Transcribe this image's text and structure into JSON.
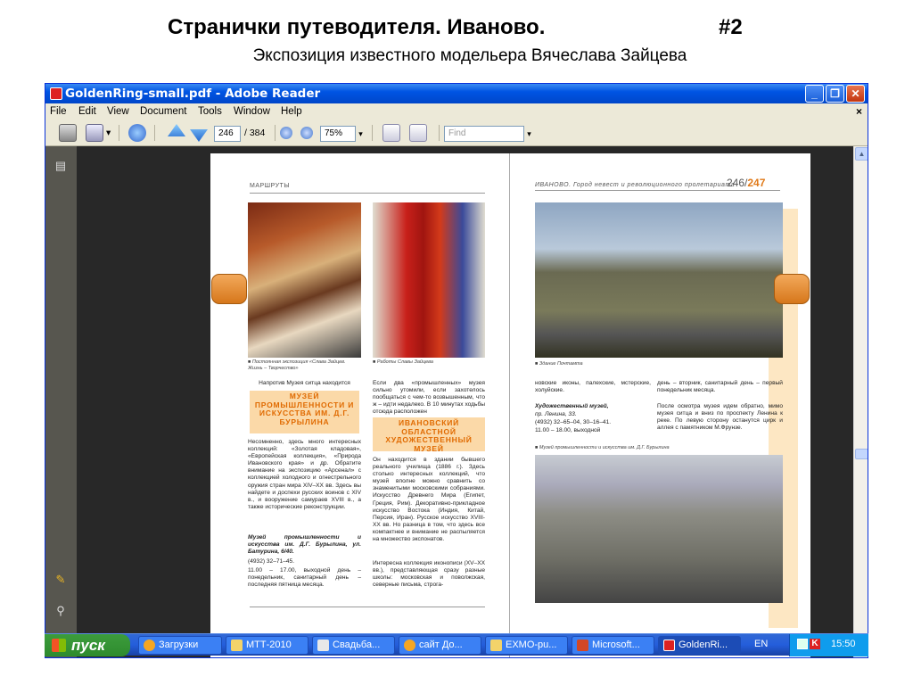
{
  "slide": {
    "title": "Странички путеводителя. Иваново.",
    "number": "#2",
    "subtitle": "Экспозиция известного модельера Вячеслава Зайцева"
  },
  "window": {
    "title": "GoldenRing-small.pdf - Adobe Reader",
    "min": "_",
    "max": "❐",
    "close": "✕"
  },
  "menu": [
    "File",
    "Edit",
    "View",
    "Document",
    "Tools",
    "Window",
    "Help"
  ],
  "menu_close": "×",
  "toolbar": {
    "page_current": "246",
    "page_total": "/ 384",
    "zoom": "75%",
    "find_placeholder": "Find"
  },
  "icons": [
    "print-icon",
    "email-icon",
    "hand-icon",
    "arrow-up-icon",
    "arrow-down-icon",
    "zoom-out-icon",
    "zoom-in-icon",
    "fit-width-icon",
    "fit-page-icon",
    "pages-icon",
    "comment-icon",
    "attachment-icon"
  ],
  "left_page": {
    "header": "МАРШРУТЫ",
    "caption1": "■ Постоянная экспозиция «Слава Зайцев. Жизнь – Творчество»",
    "caption2": "■ Работы Славы Зайцева",
    "col1_intro": "Напротив Музея ситца находится",
    "box1": "МУЗЕЙ ПРОМЫШЛЕННОСТИ И ИСКУССТВА ИМ. Д.Г. БУРЫЛИНА",
    "col1_body": "Несомненно, здесь много интересных коллекций: «Золотая кладовая», «Европейская коллекция», «Природа Ивановского края» и др. Обратите внимание на экспозицию «Арсенал» с коллекцией холодного и огнестрельного оружия стран мира XIV–XX вв. Здесь вы найдете и доспехи русских воинов с XIV в., и вооружение самураев XVIII в., а также исторические реконструкции.",
    "col1_info": "Музей промышленности и искусства им. Д.Г. Бурылина, ул. Батурина, 6/40.",
    "col1_phone": "(4932) 32–71–45.",
    "col1_hours": "11.00 – 17.00, выходной день – понедельник, санитарный день – последняя пятница месяца.",
    "col2_intro": "Если два «промышленных» музея сильно утомили, если захотелось пообщаться с чем-то возвышенным, что ж – идти недалеко. В 10 минутах ходьбы отсюда расположен",
    "box2": "ИВАНОВСКИЙ ОБЛАСТНОЙ ХУДОЖЕСТВЕННЫЙ МУЗЕЙ",
    "col2_body": "Он находится в здании бывшего реального училища (1886 г.). Здесь столько интересных коллекций, что музей вполне можно сравнить со знаменитыми московскими собраниями. Искусство Древнего Мира (Египет, Греция, Рим). Декоративно-прикладное искусство Востока (Индия, Китай, Персия, Иран). Русское искусство XVIII-XX вв. Но разница в том, что здесь все компактнее и внимание не распыляется на множество экспонатов.",
    "col2_body2": "Интересна коллекция иконописи (XV–XX вв.), представляющая сразу разные школы: московская и поволжская, северные письма, строга-"
  },
  "right_page": {
    "header": "ИВАНОВО. Город невест и революционного пролетариата",
    "page_a": "246/",
    "page_b": "247",
    "caption1": "■ Здание Почтамта",
    "col1_text": "новские иконы, палехские, мстерские, холуйские.",
    "col1_museum": "Художественный музей,",
    "col1_addr": "пр. Ленина, 33.",
    "col1_phone": "(4932) 32–65–04, 30–16–41.",
    "col1_hours": "11.00 – 18.00, выходной",
    "col2_hours": "день – вторник, санитарный день – первый понедельник месяца.",
    "col2_body": "После осмотра музея идем обратно, мимо музея ситца и вниз по проспекту Ленина к реке. По левую сторону останутся цирк и аллея с памятником М.Фрунзе.",
    "caption2": "■ Музей промышленности и искусства им. Д.Г. Бурылина"
  },
  "taskbar": {
    "start": "пуск",
    "tasks": [
      "Загрузки",
      "МТТ-2010",
      "Свадьба...",
      "сайт До...",
      "EXMO-pu...",
      "Microsoft...",
      "GoldenRi..."
    ],
    "lang": "EN",
    "clock": "15:50"
  }
}
